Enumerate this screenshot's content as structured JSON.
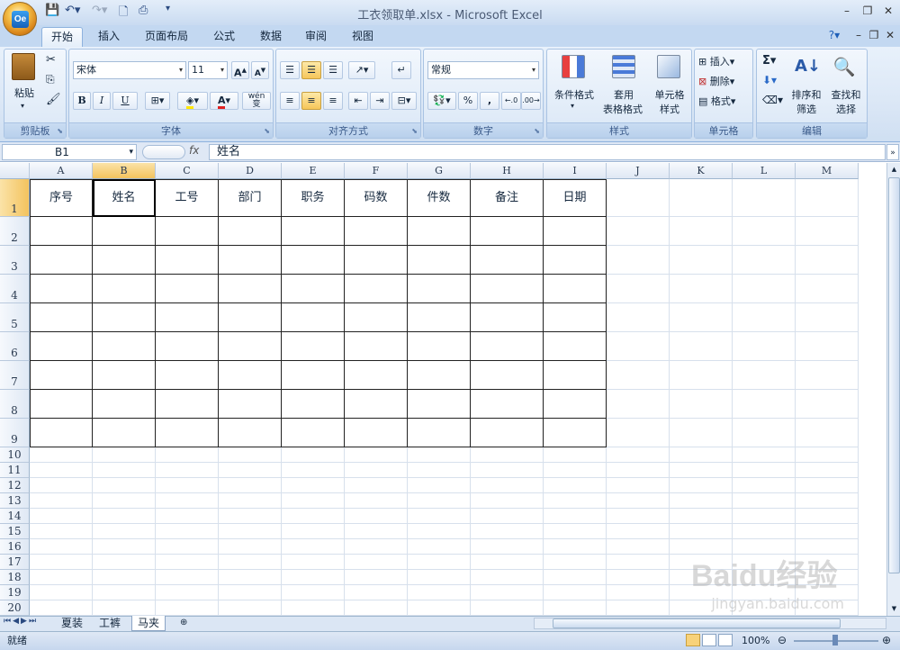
{
  "title": "工衣领取单.xlsx - Microsoft Excel",
  "ribbon_tabs": [
    "开始",
    "插入",
    "页面布局",
    "公式",
    "数据",
    "审阅",
    "视图"
  ],
  "ribbon": {
    "clipboard": {
      "label": "剪贴板",
      "paste": "粘贴"
    },
    "font": {
      "label": "字体",
      "font_name": "宋体",
      "font_size": "11",
      "bold": "B",
      "italic": "I",
      "underline": "U",
      "phonetic": "wén\n变"
    },
    "alignment": {
      "label": "对齐方式"
    },
    "number": {
      "label": "数字",
      "format": "常规",
      "percent": "%",
      "comma": ","
    },
    "styles": {
      "label": "样式",
      "conditional": "条件格式",
      "table1": "套用",
      "table2": "表格格式",
      "cell1": "单元格",
      "cell2": "样式"
    },
    "cells": {
      "label": "单元格",
      "insert": "插入",
      "delete": "删除",
      "format": "格式"
    },
    "editing": {
      "label": "编辑",
      "sort1": "排序和",
      "sort2": "筛选",
      "find1": "查找和",
      "find2": "选择"
    }
  },
  "formula_bar": {
    "name_box": "B1",
    "fx": "fx",
    "content": "姓名"
  },
  "columns": [
    "A",
    "B",
    "C",
    "D",
    "E",
    "F",
    "G",
    "H",
    "I",
    "J",
    "K",
    "L",
    "M"
  ],
  "rows": [
    "1",
    "2",
    "3",
    "4",
    "5",
    "6",
    "7",
    "8",
    "9",
    "10",
    "11",
    "12",
    "13",
    "14",
    "15",
    "16",
    "17",
    "18",
    "19",
    "20"
  ],
  "headers": [
    "序号",
    "姓名",
    "工号",
    "部门",
    "职务",
    "码数",
    "件数",
    "备注",
    "日期"
  ],
  "sheet_tabs": [
    "夏装",
    "工裤",
    "马夹"
  ],
  "active_sheet": "马夹",
  "status": {
    "ready": "就绪",
    "zoom": "100%"
  },
  "watermark": {
    "logo": "Baidu经验",
    "url": "jingyan.baidu.com"
  },
  "colors": {
    "accent": "#f3c35e",
    "ribbon": "#dbe7f6",
    "title": "#c9dbf1"
  }
}
